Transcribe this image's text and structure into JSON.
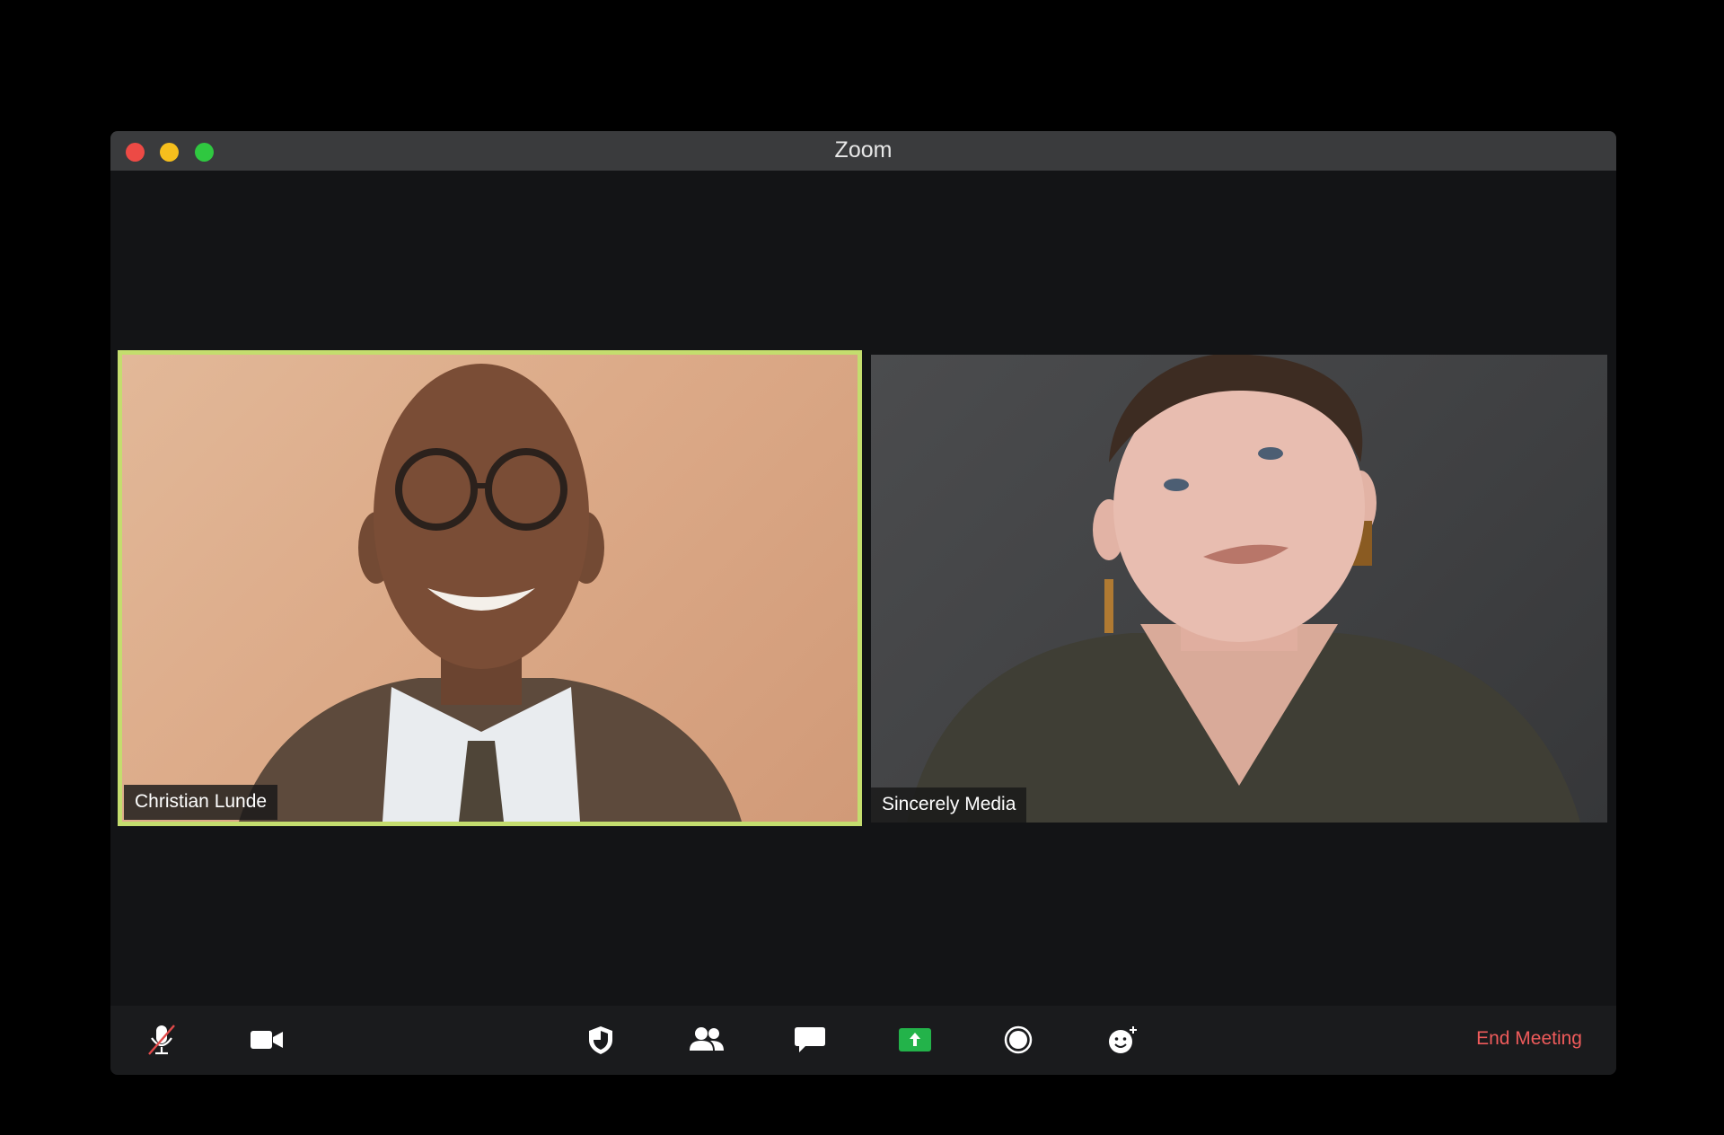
{
  "window": {
    "title": "Zoom"
  },
  "participants": [
    {
      "name": "Christian Lunde",
      "active_speaker": true
    },
    {
      "name": "Sincerely Media",
      "active_speaker": false
    }
  ],
  "toolbar": {
    "buttons": [
      {
        "name": "mute",
        "icon": "mic-muted-icon"
      },
      {
        "name": "video",
        "icon": "camera-icon"
      },
      {
        "name": "security",
        "icon": "shield-icon"
      },
      {
        "name": "participants",
        "icon": "people-icon"
      },
      {
        "name": "chat",
        "icon": "chat-icon"
      },
      {
        "name": "share-screen",
        "icon": "share-screen-icon"
      },
      {
        "name": "record",
        "icon": "record-icon"
      },
      {
        "name": "reactions",
        "icon": "reaction-icon"
      }
    ],
    "end_label": "End Meeting"
  },
  "colors": {
    "active_speaker_border": "#c4dd6e",
    "end_meeting": "#ef5b5b",
    "share_green": "#23b34a"
  }
}
